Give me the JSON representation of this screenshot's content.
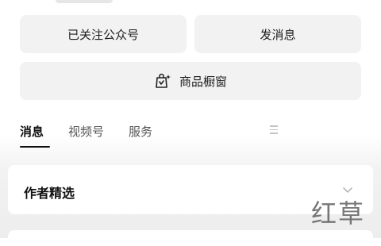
{
  "actions": {
    "follow_label": "已关注公众号",
    "message_label": "发消息",
    "shop_label": "商品橱窗"
  },
  "tabs": [
    {
      "label": "消息",
      "active": true
    },
    {
      "label": "视频号",
      "active": false
    },
    {
      "label": "服务",
      "active": false
    }
  ],
  "card": {
    "title": "作者精选"
  },
  "watermark": "红草",
  "icons": {
    "shop": "shopping-bag-icon",
    "menu": "menu-icon",
    "chevron": "chevron-down-icon"
  },
  "colors": {
    "button_bg": "#f2f2f2",
    "active_tab": "#111111",
    "inactive_tab": "#555555"
  }
}
